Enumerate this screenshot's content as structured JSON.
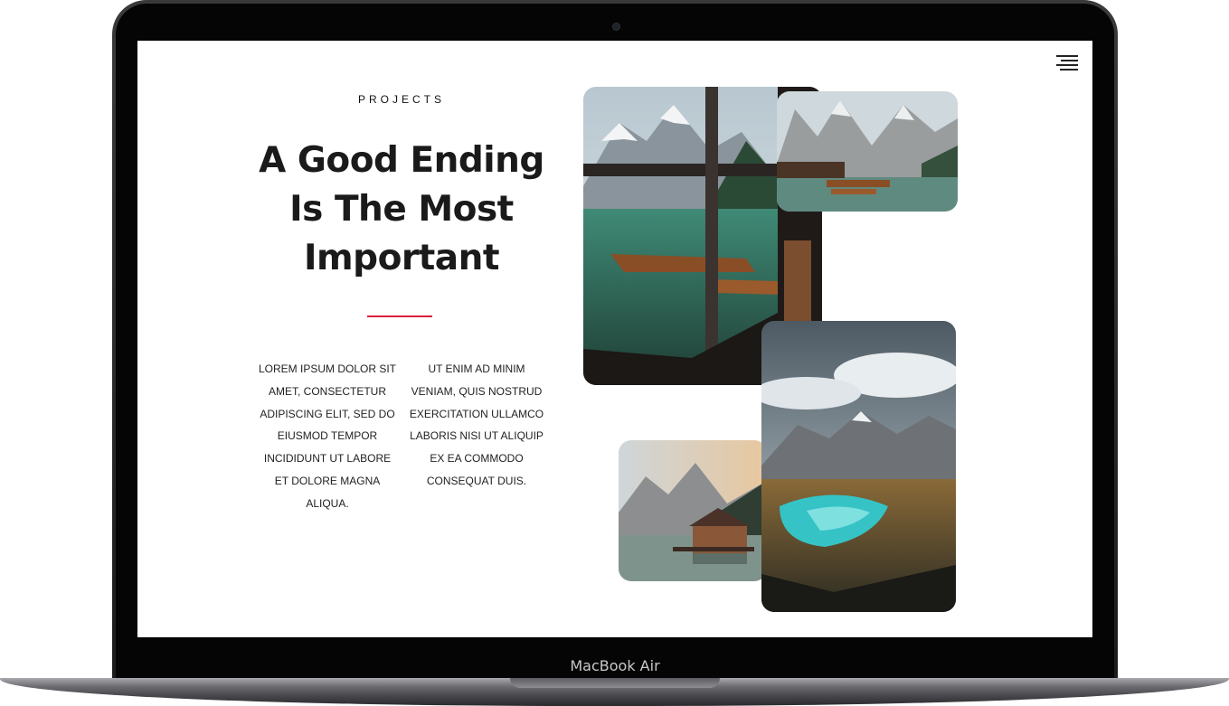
{
  "device": {
    "label": "MacBook Air"
  },
  "page": {
    "eyebrow": "PROJECTS",
    "headline_lines": [
      "A Good Ending",
      "Is The Most",
      "Important"
    ],
    "column_left_lines": [
      "LOREM IPSUM DOLOR SIT",
      "AMET, CONSECTETUR",
      "ADIPISCING ELIT, SED DO",
      "EIUSMOD TEMPOR",
      "INCIDIDUNT UT LABORE",
      "ET DOLORE MAGNA",
      "ALIQUA."
    ],
    "column_right_lines": [
      "UT ENIM AD MINIM",
      "VENIAM, QUIS NOSTRUD",
      "EXERCITATION ULLAMCO",
      "LABORIS NISI UT ALIQUIP",
      "EX EA COMMODO",
      "CONSEQUAT DUIS."
    ]
  },
  "icons": {
    "menu": "hamburger-menu-icon"
  },
  "colors": {
    "accent": "#d9203a",
    "text": "#1a1a1a",
    "background": "#ffffff"
  }
}
